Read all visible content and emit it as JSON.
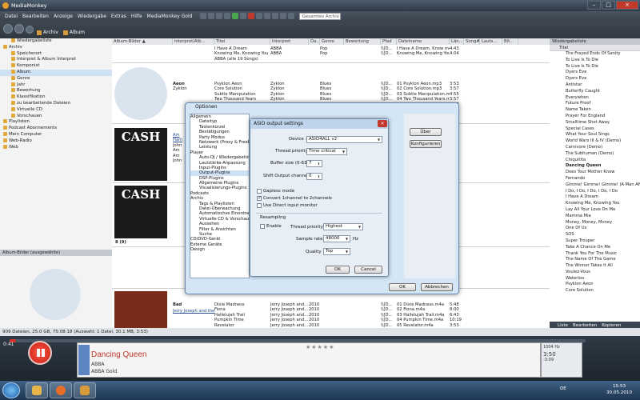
{
  "window": {
    "title": "MediaMonkey"
  },
  "menu": [
    "Datei",
    "Bearbeiten",
    "Anzeige",
    "Wiedergabe",
    "Extras",
    "Hilfe",
    "MediaMonkey Gold"
  ],
  "menu_search_placeholder": "Gesamtes Archiv",
  "breadcrumb": [
    "Archiv",
    "Album"
  ],
  "tree": [
    {
      "label": "Wiedergabeliste",
      "level": 1
    },
    {
      "label": "Archiv",
      "level": 0
    },
    {
      "label": "Speicherort",
      "level": 1
    },
    {
      "label": "Interpret & Album Interpret",
      "level": 1
    },
    {
      "label": "Komponist",
      "level": 1
    },
    {
      "label": "Album",
      "level": 1,
      "selected": true
    },
    {
      "label": "Genre",
      "level": 1
    },
    {
      "label": "Jahr",
      "level": 1
    },
    {
      "label": "Bewertung",
      "level": 1
    },
    {
      "label": "Klassifikation",
      "level": 1
    },
    {
      "label": "zu bearbeitende Dateien",
      "level": 1
    },
    {
      "label": "Virtuelle CD",
      "level": 1
    },
    {
      "label": "Vorschauen",
      "level": 1
    },
    {
      "label": "Playlisten",
      "level": 0
    },
    {
      "label": "Podcast Abonnements",
      "level": 0
    },
    {
      "label": "Mein Computer",
      "level": 0
    },
    {
      "label": "Web-Radio",
      "level": 0
    },
    {
      "label": "Web",
      "level": 0
    }
  ],
  "album_pane_title": "Album-Bilder (ausgewählte)",
  "columns": [
    "Album-Bilder ▲",
    "Interpret/Alb...",
    "Titel",
    "Interpret",
    "Da...",
    "Genre",
    "Bewertung",
    "Pfad",
    "Dateiname",
    "Län...",
    "Song#",
    "Lauts...",
    "Bit..."
  ],
  "top_rows": [
    {
      "title": "I Have A Dream",
      "artist": "ABBA",
      "genre": "Pop",
      "path": "\\\\[D...",
      "file": "I Have A Dream, Know m4a",
      "len": "4:43"
    },
    {
      "title": "Knowing Me, Knowing You",
      "artist": "ABBA",
      "genre": "Pop",
      "path": "\\\\[D...",
      "file": "Knowing Me, Knowing You.m4a",
      "len": "4:04"
    },
    {
      "title": "ABBA (alle 19 Songs)",
      "artist": "",
      "genre": "",
      "path": "",
      "file": "",
      "len": ""
    }
  ],
  "aeon_group": {
    "album": "Aeon",
    "artist": "Zyklon",
    "rows": [
      {
        "title": "Psyklon Aeon",
        "artist": "Zyklon",
        "genre": "Blues",
        "path": "\\\\[D...",
        "file": "01 Psyklon Aeon.mp3",
        "len": "3:53"
      },
      {
        "title": "Core Solution",
        "artist": "Zyklon",
        "genre": "Blues",
        "path": "\\\\[D...",
        "file": "02 Core Solution.mp3",
        "len": "3:57"
      },
      {
        "title": "Subtle Manipulation",
        "artist": "Zyklon",
        "genre": "Blues",
        "path": "\\\\[D...",
        "file": "03 Subtle Manipulation.mp3",
        "len": "4:55"
      },
      {
        "title": "Two Thousand Years",
        "artist": "Zyklon",
        "genre": "Blues",
        "path": "\\\\[D...",
        "file": "04 Two Thousand Years.mp3",
        "len": "3:57"
      },
      {
        "title": "The Name Of The Game",
        "artist": "Zyklon",
        "genre": "Blues",
        "path": "\\\\[D...",
        "file": "05 The Name Of The Game.mp3",
        "len": "4:37"
      }
    ]
  },
  "cash_group": {
    "cover_text": "CASH",
    "visible_labels": [
      "Am",
      "Ham",
      "John",
      "Am",
      "Am",
      "John"
    ],
    "lengths": [
      "4:26",
      "3:38",
      "2:37",
      "2:29",
      "3:00",
      "3:24",
      "4:03"
    ]
  },
  "cash2_group": {
    "cover_text": "CASH",
    "lengths": [
      "2:53",
      "4:22",
      "2:29",
      "2:53",
      "2:49",
      "4:23"
    ],
    "count_label": "8 (9)"
  },
  "other_lengths": [
    "2:53",
    "2:53",
    "2:53",
    "2:53",
    "2:53",
    "2:53",
    "4:08"
  ],
  "bottom_group": {
    "album_label": "Bad",
    "album_artist": "Jerry Joseph and the Jackmormons",
    "rows": [
      {
        "title": "Dixie Madness",
        "artist": "Jerry Joseph and...",
        "year": "2010",
        "path": "\\\\[D...",
        "file": "01 Dixie Madness.m4a",
        "len": "5:48"
      },
      {
        "title": "Fiona",
        "artist": "Jerry Joseph and...",
        "year": "2010",
        "path": "\\\\[D...",
        "file": "02 Fiona.m4a",
        "len": "8:00"
      },
      {
        "title": "Hallelujah Trail",
        "artist": "Jerry Joseph and...",
        "year": "2010",
        "path": "\\\\[D...",
        "file": "03 Hallelujah Trail.m4a",
        "len": "6:43"
      },
      {
        "title": "Pumpkin Time",
        "artist": "Jerry Joseph and...",
        "year": "2010",
        "path": "\\\\[D...",
        "file": "04 Pumpkin Time.m4a",
        "len": "10:19"
      },
      {
        "title": "Revelator",
        "artist": "Jerry Joseph and...",
        "year": "2010",
        "path": "\\\\[D...",
        "file": "05 Revelator.m4a",
        "len": "3:53"
      }
    ]
  },
  "right_pane": {
    "title": "Wiedergabeliste",
    "header": "Titel",
    "items": [
      "The Frayed Ends Of Sanity",
      "To Live Is To Die",
      "To Live Is To Die",
      "Dyers Eve",
      "Dyers Eve",
      "Antistar",
      "Butterfly Caught",
      "Everywhen",
      "Future Proof",
      "Name Taken",
      "Prayer For England",
      "Smalltime Shot Away",
      "Special Cases",
      "What Your Soul Sings",
      "World Wars III & IV (Demo)",
      "Carnivore (Demo)",
      "The Subhuman (Demo)",
      "Chiquitita",
      "Dancing Queen",
      "Does Your Mother Know",
      "Fernando",
      "Gimme! Gimme! Gimme! (A Man After Midnight)",
      "I Do, I Do, I Do, I Do, I Do",
      "I Have A Dream",
      "Knowing Me, Knowing You",
      "Lay All Your Love On Me",
      "Mamma Mia",
      "Money, Money, Money",
      "One Of Us",
      "SOS",
      "Super Trouper",
      "Take A Chance On Me",
      "Thank You For The Music",
      "The Name Of The Game",
      "The Winner Takes It All",
      "Voulez-Vous",
      "Waterloo",
      "Psyklon Aeon",
      "Core Solution"
    ],
    "current": "Dancing Queen",
    "footer": [
      "Liste",
      "Bearbeiten",
      "Kopieren"
    ]
  },
  "status": "909 Dateien, 25.0 GB, 75:08:18 (Auswahl: 1 Datei, 30.1 MB, 3:53)",
  "player": {
    "time": "0:41",
    "now_title": "Dancing Queen",
    "now_artist": "ABBA",
    "now_album": "ABBA Gold",
    "stars": "★★★★★",
    "time_box": [
      "1004 Hz",
      "3:50",
      "-3:09"
    ]
  },
  "options_dialog": {
    "title": "Optionen",
    "tree": [
      {
        "label": "Allgemein",
        "sub": false
      },
      {
        "label": "Dateityp",
        "sub": true
      },
      {
        "label": "Tastenkürzel",
        "sub": true
      },
      {
        "label": "Bestätigungen",
        "sub": true
      },
      {
        "label": "Party Modus",
        "sub": true
      },
      {
        "label": "Netzwerk (Proxy & FreeDB)",
        "sub": true
      },
      {
        "label": "Leistung",
        "sub": true
      },
      {
        "label": "Player",
        "sub": false
      },
      {
        "label": "Auto-DJ / Wiedergabeliste",
        "sub": true
      },
      {
        "label": "Lautstärke-Anpassung",
        "sub": true
      },
      {
        "label": "Input-Plugins",
        "sub": true
      },
      {
        "label": "Output-Plugins",
        "sub": true,
        "selected": true
      },
      {
        "label": "DSP-Plugins",
        "sub": true
      },
      {
        "label": "Allgemeine Plugins",
        "sub": true
      },
      {
        "label": "Visualisierungs-Plugins",
        "sub": true
      },
      {
        "label": "Podcasts",
        "sub": false
      },
      {
        "label": "Archiv",
        "sub": false
      },
      {
        "label": "Tags & Playlisten",
        "sub": true
      },
      {
        "label": "Datei-Überwachung",
        "sub": true
      },
      {
        "label": "Automatisches Einordnen",
        "sub": true
      },
      {
        "label": "Virtuelle CD & Vorschau",
        "sub": true
      },
      {
        "label": "Aussehen",
        "sub": true
      },
      {
        "label": "Filter & Ansichten",
        "sub": true
      },
      {
        "label": "Suche",
        "sub": true
      },
      {
        "label": "CD/DVD-Gerät",
        "sub": false
      },
      {
        "label": "Externe Geräte",
        "sub": false
      },
      {
        "label": "Design",
        "sub": false
      }
    ],
    "about_button": "Über",
    "configure_button": "Konfigurieren",
    "ok_button": "OK",
    "cancel_button": "Abbrechen"
  },
  "asio_dialog": {
    "title": "ASIO output settings",
    "device_label": "Device :",
    "device_value": "ASIO4ALL v2",
    "thread_priority_label": "Thread priority :",
    "thread_priority_value": "Time critical",
    "buffer_label": "Buffer size (0-63) :",
    "buffer_value": "7",
    "shift_label": "Shift Output channels :",
    "shift_value": "0",
    "gapless_label": "Gapless mode",
    "gapless_checked": false,
    "convert_label": "Convert 1channel to 2channels",
    "convert_checked": true,
    "direct_label": "Use Direct input monitor",
    "direct_checked": false,
    "resampling_label": "Resampling",
    "enable_label": "Enable",
    "enable_checked": false,
    "rs_thread_label": "Thread priority :",
    "rs_thread_value": "Highest",
    "sample_rate_label": "Sample rate :",
    "sample_rate_value": "48000",
    "sample_rate_unit": "Hz",
    "quality_label": "Quality :",
    "quality_value": "Top",
    "ok_button": "OK",
    "cancel_button": "Cancel"
  },
  "taskbar": {
    "lang": "DE",
    "time": "15:53",
    "date": "30.05.2010"
  },
  "colors": {
    "accent": "#c0392b",
    "title_bar": "#2c3845",
    "selection": "#cfe2f5"
  }
}
